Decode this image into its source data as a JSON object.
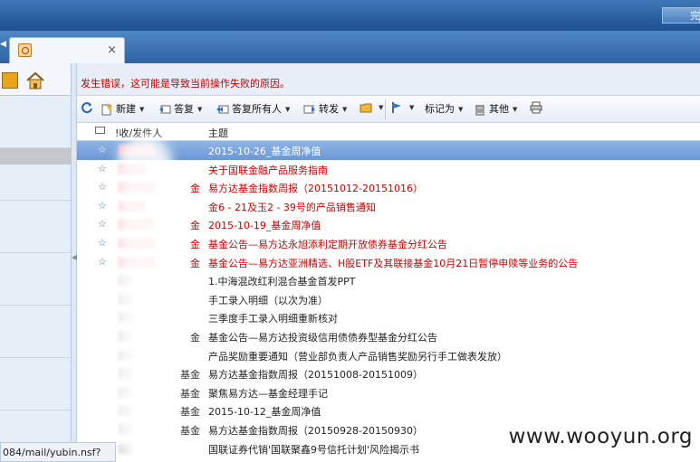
{
  "window": {
    "top_right_button": "完"
  },
  "tab": {
    "close": "×"
  },
  "error_message": "发生错误，这可能是导致当前操作失败的原因。",
  "toolbar": {
    "new": "新建",
    "reply": "答复",
    "reply_all": "答复所有人",
    "forward": "转发",
    "mark_as": "标记为",
    "other": "其他"
  },
  "list": {
    "col_from": "!收/发件人",
    "col_subject": "主题",
    "rows": [
      {
        "from": "",
        "subject": "2015-10-26_基金周净值",
        "selected": true,
        "unread": false,
        "starred": true
      },
      {
        "from": "",
        "subject": "关于国联金融产品服务指南",
        "selected": false,
        "unread": true,
        "starred": true
      },
      {
        "from": "金",
        "subject": "易方达基金指数周报（20151012-20151016）",
        "selected": false,
        "unread": true,
        "starred": true
      },
      {
        "from": "",
        "subject": "金6 - 21及玉2 - 39号的产品销售通知",
        "selected": false,
        "unread": true,
        "starred": true
      },
      {
        "from": "金",
        "subject": "2015-10-19_基金周净值",
        "selected": false,
        "unread": true,
        "starred": true
      },
      {
        "from": "金",
        "subject": "基金公告—易方达永旭添利定期开放债券基金分红公告",
        "selected": false,
        "unread": true,
        "starred": true
      },
      {
        "from": "金",
        "subject": "基金公告—易方达亚洲精选、H股ETF及其联接基金10月21日暂停申赎等业务的公告",
        "selected": false,
        "unread": true,
        "starred": true
      },
      {
        "from": "",
        "subject": "1.中海混改红利混合基金首发PPT",
        "selected": false,
        "unread": false,
        "starred": false
      },
      {
        "from": "",
        "subject": "手工录入明细（以次为准）",
        "selected": false,
        "unread": false,
        "starred": false
      },
      {
        "from": "",
        "subject": "三季度手工录入明细重新核对",
        "selected": false,
        "unread": false,
        "starred": false
      },
      {
        "from": "金",
        "subject": "基金公告—易方达投资级信用债债券型基金分红公告",
        "selected": false,
        "unread": false,
        "starred": false
      },
      {
        "from": "",
        "subject": "产品奖励重要通知（营业部负责人产品销售奖励另行手工做表发放）",
        "selected": false,
        "unread": false,
        "starred": false
      },
      {
        "from": "基金",
        "subject": "易方达基金指数周报（20151008-20151009）",
        "selected": false,
        "unread": false,
        "starred": false
      },
      {
        "from": "基金",
        "subject": "聚焦易方达—基金经理手记",
        "selected": false,
        "unread": false,
        "starred": false
      },
      {
        "from": "基金",
        "subject": "2015-10-12_基金周净值",
        "selected": false,
        "unread": false,
        "starred": false
      },
      {
        "from": "基金",
        "subject": "易方达基金指数周报（20150928-20150930）",
        "selected": false,
        "unread": false,
        "starred": false
      },
      {
        "from": "",
        "subject": "国联证券代销'国联聚鑫9号信托计划'风险揭示书",
        "selected": false,
        "unread": false,
        "starred": false
      }
    ]
  },
  "status_url": "084/mail/yubin.nsf?",
  "watermark": "www.wooyun.org",
  "colors": {
    "unread_text": "#d00000",
    "selected_row": "#7aa6de",
    "error_text": "#c00000"
  }
}
